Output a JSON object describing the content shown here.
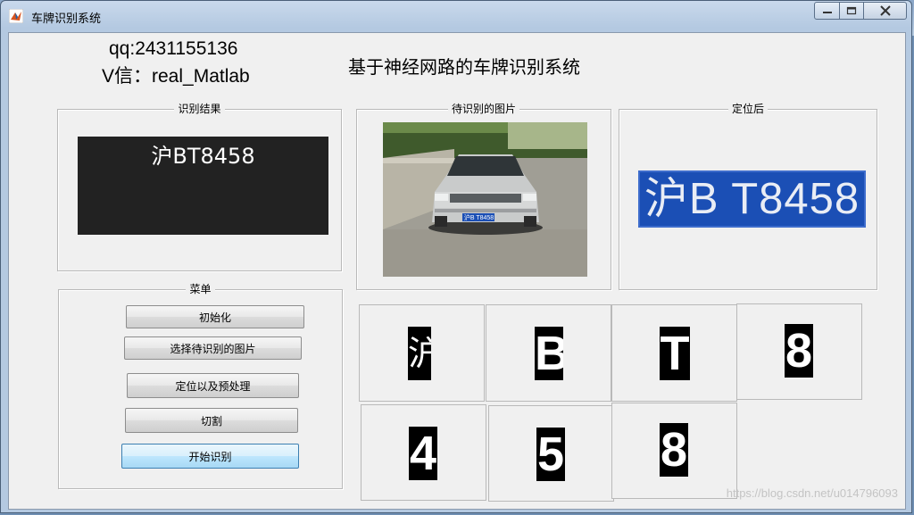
{
  "window": {
    "title": "车牌识别系统"
  },
  "header": {
    "qq": "qq:2431155136",
    "vx": "V信：real_Matlab",
    "title": "基于神经网路的车牌识别系统"
  },
  "panels": {
    "result": {
      "label": "识别结果",
      "value": "沪BT8458"
    },
    "image": {
      "label": "待识别的图片",
      "plate_text": "沪B T8458"
    },
    "located": {
      "label": "定位后",
      "plate_text": "沪B T8458"
    },
    "menu": {
      "label": "菜单"
    }
  },
  "menu": {
    "buttons": [
      {
        "label": "初始化"
      },
      {
        "label": "选择待识别的图片"
      },
      {
        "label": "定位以及预处理"
      },
      {
        "label": "切割"
      },
      {
        "label": "开始识别"
      }
    ]
  },
  "segments": [
    "沪",
    "B",
    "T",
    "8",
    "4",
    "5",
    "8"
  ],
  "watermark": "https://blog.csdn.net/u014796093",
  "colors": {
    "plate_blue": "#1b4fb5",
    "result_bg": "#222222",
    "client_bg": "#f0f0f0"
  }
}
